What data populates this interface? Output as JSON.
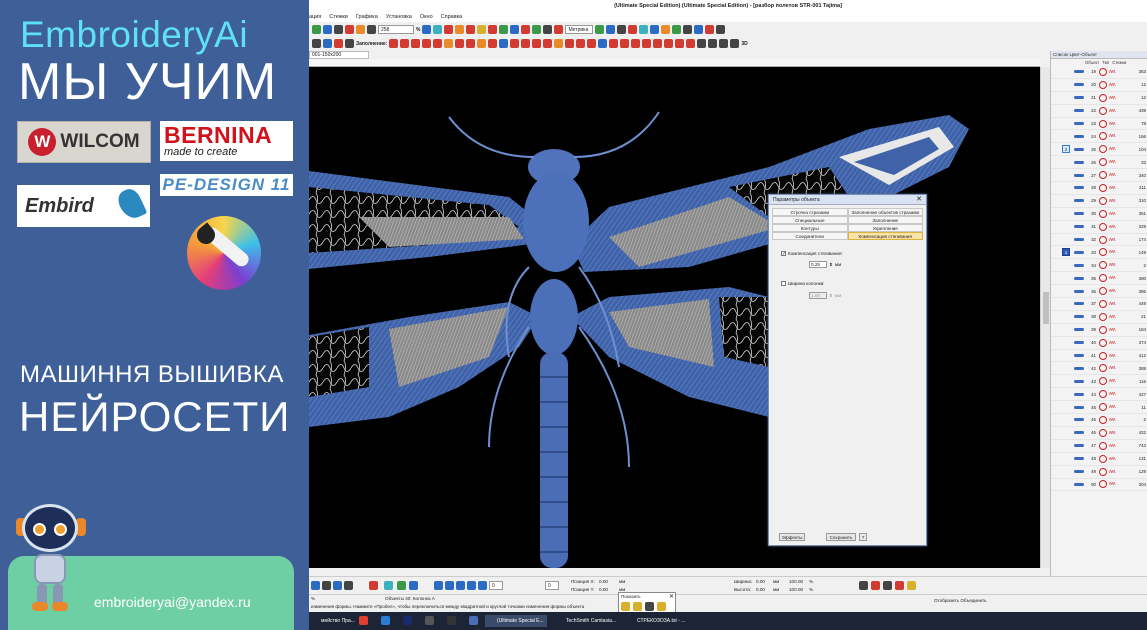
{
  "promo": {
    "brand": "EmbroideryAi",
    "headline": "МЫ УЧИМ",
    "logos": {
      "wilcom": "WILCOM",
      "wilcom_mark": "W",
      "bernina": "BERNINA",
      "bernina_tagline": "made to create",
      "embird": "Embird",
      "pedesign": "PE-DESIGN 11"
    },
    "subtitle_1": "МАШИННЯ ВЫШИВКА",
    "subtitle_2": "НЕЙРОСЕТИ",
    "email": "embroideryai@yandex.ru",
    "colors": {
      "panel": "#3e5f97",
      "brand": "#5ee0f5",
      "contact": "#6fcfa4"
    }
  },
  "app": {
    "title": "(Ultimate Special Edition) (Ultimate Special Edition) - [разбор полетов STR-001     Tajima]",
    "menu": [
      "ация",
      "Стежки",
      "Графика",
      "Установка",
      "Окно",
      "Справка"
    ],
    "zoom_value": "258",
    "zoom_unit": "%",
    "units_value": "Метрика",
    "fill_label": "Заполнение:",
    "doc_tab": "001-150x200",
    "toolbar_3d": "3D"
  },
  "dialog": {
    "title": "Параметры объекта",
    "tabs": [
      {
        "label": "Строчка стразами",
        "active": false
      },
      {
        "label": "Заполнение объектов стразами",
        "active": false
      },
      {
        "label": "Специальные",
        "active": false
      },
      {
        "label": "Заполнение",
        "active": false
      },
      {
        "label": "Контуры",
        "active": false
      },
      {
        "label": "Укрепление",
        "active": false
      },
      {
        "label": "Соединители",
        "active": false
      },
      {
        "label": "Компенсация стягивания",
        "active": true
      }
    ],
    "comp_checkbox_label": "Компенсация стягивания:",
    "comp_checked": true,
    "comp_value": "0.25",
    "comp_unit": "мм",
    "width_checkbox_label": "Ширина колонки:",
    "width_checked": false,
    "width_value": "1.00",
    "width_unit": "мм",
    "btn_effects": "Эффекты",
    "btn_save": "Сохранить",
    "btn_help": "?"
  },
  "right_panel": {
    "header": "Список Цвет-Объект",
    "columns": [
      "Объект",
      "Тип",
      "Стежки"
    ],
    "rows": [
      {
        "id": "19",
        "val": "363"
      },
      {
        "id": "20",
        "val": "12"
      },
      {
        "id": "21",
        "val": "12"
      },
      {
        "id": "22",
        "val": "439"
      },
      {
        "id": "23",
        "val": "78"
      },
      {
        "id": "24",
        "val": "166"
      },
      {
        "id": "25",
        "val": "104",
        "sel": "2"
      },
      {
        "id": "26",
        "val": "33"
      },
      {
        "id": "27",
        "val": "340"
      },
      {
        "id": "28",
        "val": "211"
      },
      {
        "id": "29",
        "val": "310"
      },
      {
        "id": "30",
        "val": "351"
      },
      {
        "id": "31",
        "val": "329"
      },
      {
        "id": "32",
        "val": "174"
      },
      {
        "id": "33",
        "val": "149",
        "sel": "1"
      },
      {
        "id": "34",
        "val": "2"
      },
      {
        "id": "35",
        "val": "380"
      },
      {
        "id": "36",
        "val": "385"
      },
      {
        "id": "37",
        "val": "449"
      },
      {
        "id": "38",
        "val": "21"
      },
      {
        "id": "39",
        "val": "184"
      },
      {
        "id": "40",
        "val": "374"
      },
      {
        "id": "41",
        "val": "412"
      },
      {
        "id": "42",
        "val": "388"
      },
      {
        "id": "43",
        "val": "116"
      },
      {
        "id": "44",
        "val": "427"
      },
      {
        "id": "45",
        "val": "11"
      },
      {
        "id": "46",
        "val": "2"
      },
      {
        "id": "46",
        "val": "422"
      },
      {
        "id": "47",
        "val": "743"
      },
      {
        "id": "48",
        "val": "131"
      },
      {
        "id": "49",
        "val": "129"
      },
      {
        "id": "50",
        "val": "304"
      }
    ]
  },
  "bottom": {
    "pos_x_label": "Позиция X:",
    "pos_x_value": "0.00",
    "pos_y_label": "Позиция Y:",
    "pos_y_value": "0.00",
    "width_label": "Ширина:",
    "width_value": "0.00",
    "height_label": "Высота:",
    "height_value": "0.00",
    "w_pct": "100.00",
    "h_pct": "100.00",
    "unit_mm": "мм",
    "unit_pct": "%",
    "zoom_pct": "%",
    "spin_value": "0",
    "status_objects": "Объекты 40: Колонка A",
    "status_hint": "изменения формы. Нажмите «Пробел», чтобы переключиться между квадратной и круглой точками изменения формы объекта",
    "show_label": "Показать",
    "show_objects": "Отобразить Объединить"
  },
  "taskbar": {
    "items": [
      "мейство Пра...",
      "(Ultimate Special E...",
      "TechSmith Camtasia...",
      "СТРЕКОЗОЗА.txt - ..."
    ]
  }
}
